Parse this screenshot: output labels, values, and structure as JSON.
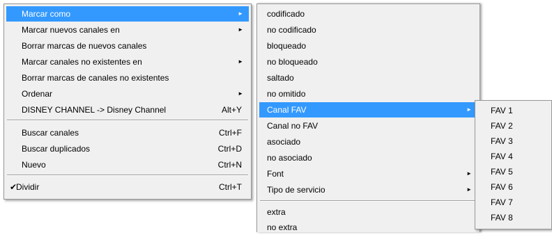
{
  "main_menu": {
    "items": [
      {
        "label": "Marcar como",
        "submenu": true,
        "highlighted": true
      },
      {
        "label": "Marcar nuevos canales en",
        "submenu": true
      },
      {
        "label": "Borrar marcas de nuevos canales"
      },
      {
        "label": "Marcar canales no existentes en",
        "submenu": true
      },
      {
        "label": "Borrar marcas de canales no existentes"
      },
      {
        "label": "Ordenar",
        "submenu": true
      },
      {
        "label": "DISNEY CHANNEL -> Disney Channel",
        "shortcut": "Alt+Y"
      },
      {
        "label": "Buscar canales",
        "shortcut": "Ctrl+F"
      },
      {
        "label": "Buscar duplicados",
        "shortcut": "Ctrl+D"
      },
      {
        "label": "Nuevo",
        "shortcut": "Ctrl+N"
      },
      {
        "label": "Dividir",
        "shortcut": "Ctrl+T",
        "checked": true
      }
    ]
  },
  "submenu_marcar_como": {
    "items": [
      {
        "label": "codificado"
      },
      {
        "label": "no codificado"
      },
      {
        "label": "bloqueado"
      },
      {
        "label": "no bloqueado"
      },
      {
        "label": "saltado"
      },
      {
        "label": "no omitido"
      },
      {
        "label": "Canal FAV",
        "submenu": true,
        "highlighted": true
      },
      {
        "label": "Canal no FAV"
      },
      {
        "label": "asociado"
      },
      {
        "label": "no asociado"
      },
      {
        "label": "Font",
        "submenu": true
      },
      {
        "label": "Tipo de servicio",
        "submenu": true
      },
      {
        "label": "extra"
      },
      {
        "label": "no extra"
      }
    ]
  },
  "submenu_canal_fav": {
    "items": [
      {
        "label": "FAV 1"
      },
      {
        "label": "FAV 2"
      },
      {
        "label": "FAV 3"
      },
      {
        "label": "FAV 4"
      },
      {
        "label": "FAV 5"
      },
      {
        "label": "FAV 6"
      },
      {
        "label": "FAV 7"
      },
      {
        "label": "FAV 8"
      }
    ]
  },
  "glyphs": {
    "submenu_arrow": "►",
    "check": "✔"
  },
  "colors": {
    "highlight": "#3399ff",
    "menu_bg": "#f0f0f0"
  }
}
